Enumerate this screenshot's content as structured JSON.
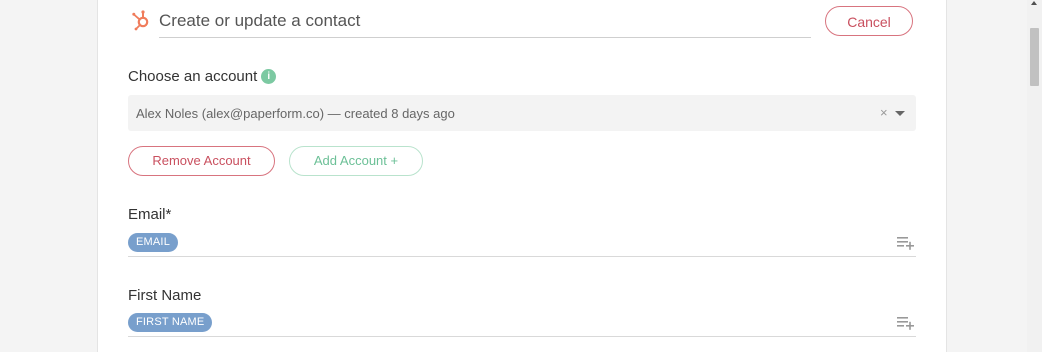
{
  "header": {
    "title": "Create or update a contact",
    "cancel_label": "Cancel",
    "logo_icon": "hubspot-sprocket-icon",
    "logo_color": "#f07c5b"
  },
  "account": {
    "label": "Choose an account",
    "info_icon_glyph": "i",
    "selected_value": "Alex Noles (alex@paperform.co) — created 8 days ago",
    "clear_glyph": "×",
    "remove_label": "Remove Account",
    "add_label": "Add Account +"
  },
  "fields": [
    {
      "label": "Email*",
      "tag": "EMAIL"
    },
    {
      "label": "First Name",
      "tag": "FIRST NAME"
    }
  ],
  "colors": {
    "accent_red": "#c9505f",
    "accent_green": "#6cc097",
    "tag_blue": "#789fcc"
  }
}
